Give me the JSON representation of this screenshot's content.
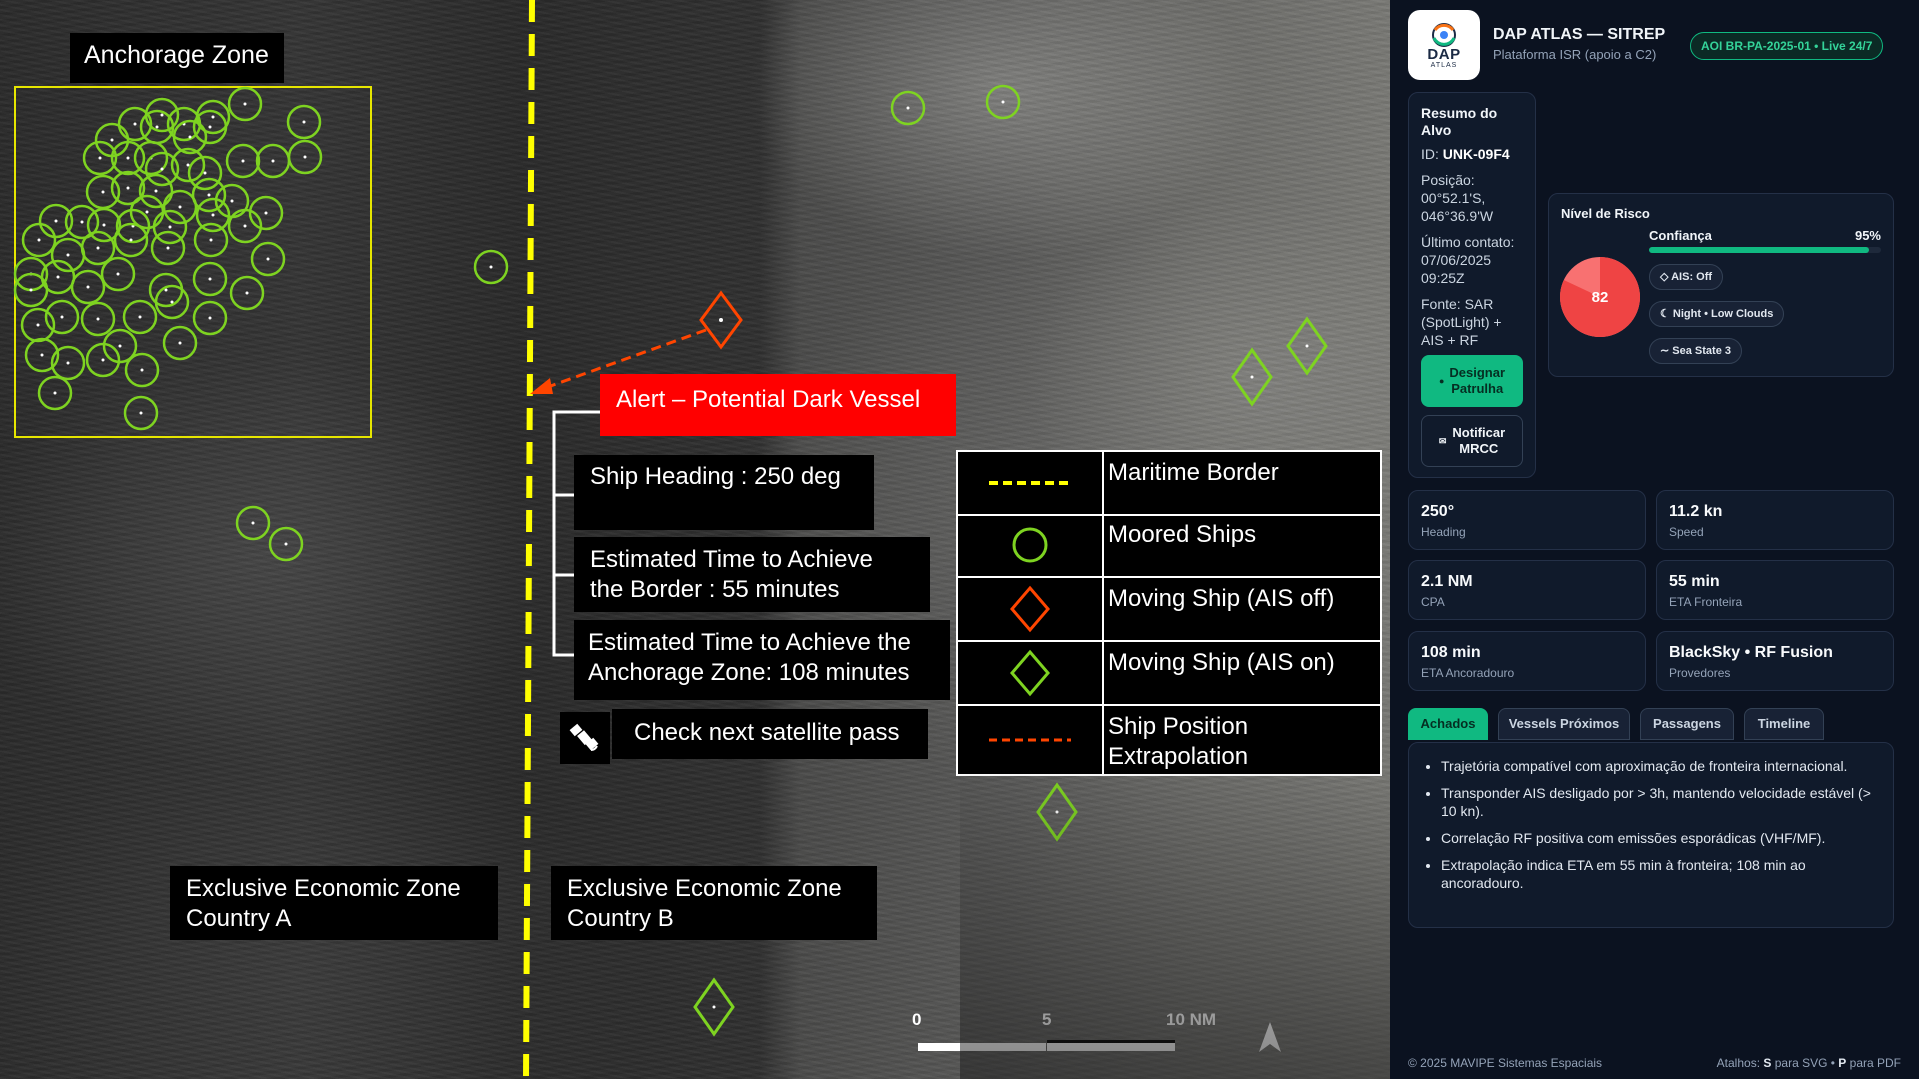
{
  "map": {
    "anchorage_label": "Anchorage Zone",
    "alert_label": "Alert – Potential Dark Vessel",
    "heading_label": "Ship Heading : 250 deg",
    "eta_border_label_1": "Estimated Time to Achieve",
    "eta_border_label_2": "the Border : 55 minutes",
    "eta_anchorage_label_1": "Estimated Time to Achieve the",
    "eta_anchorage_label_2": "Anchorage Zone: 108 minutes",
    "satellite_label": "Check next satellite pass",
    "eez_a_1": "Exclusive Economic Zone",
    "eez_a_2": "Country A",
    "eez_b_1": "Exclusive Economic Zone",
    "eez_b_2": "Country B",
    "legend": [
      {
        "label": "Maritime Border",
        "symbol": "yellow-dashed-line"
      },
      {
        "label": "Moored Ships",
        "symbol": "green-circle"
      },
      {
        "label": "Moving Ship (AIS off)",
        "symbol": "red-diamond"
      },
      {
        "label": "Moving Ship (AIS on)",
        "symbol": "green-diamond"
      },
      {
        "label": "Ship Position Extrapolation",
        "symbol": "red-dashed-line"
      }
    ],
    "scale": {
      "t0": "0",
      "t5": "5",
      "t10": "10 NM"
    },
    "north_icon": "north-arrow-icon",
    "colors": {
      "moored": "#7ed321",
      "alert": "#ff0000",
      "border": "#ffff00",
      "extrapolation": "#ff4500"
    }
  },
  "panel": {
    "logo_text": "DAP",
    "logo_sub": "ATLAS",
    "title": "DAP ATLAS — SITREP",
    "subtitle": "Plataforma ISR (apoio a C2)",
    "aoi_badge": "AOI BR-PA-2025-01 • Live 24/7",
    "summary": {
      "title_1": "Resumo do",
      "title_2": "Alvo",
      "id_label": "ID: ",
      "id_value": "UNK-09F4",
      "position_label": "Posição:",
      "position_1": "00°52.1'S,",
      "position_2": "046°36.9'W",
      "contact_label": "Último contato:",
      "contact_1": "07/06/2025",
      "contact_2": "09:25Z",
      "source_label": "Fonte: ",
      "source_1": "SAR",
      "source_2": "(SpotLight) +",
      "source_3": "AIS + RF"
    },
    "actions": {
      "designate_1": "Designar",
      "designate_2": "Patrulha",
      "notify_1": "Notificar",
      "notify_2": "MRCC"
    },
    "risk": {
      "title": "Nível de Risco",
      "score": "82",
      "score_value": 82,
      "confidence_label": "Confiança",
      "confidence_value": "95%",
      "confidence_fraction": 0.95,
      "chips": [
        "AIS: Off",
        "Night • Low Clouds",
        "Sea State 3"
      ]
    },
    "stats": [
      {
        "value": "250°",
        "label": "Heading"
      },
      {
        "value": "11.2 kn",
        "label": "Speed"
      },
      {
        "value": "2.1 NM",
        "label": "CPA"
      },
      {
        "value": "55 min",
        "label": "ETA Fronteira"
      },
      {
        "value": "108 min",
        "label": "ETA Ancoradouro"
      },
      {
        "value": "BlackSky • RF Fusion",
        "label": "Provedores"
      }
    ],
    "tabs": [
      "Achados",
      "Vessels Próximos",
      "Passagens",
      "Timeline"
    ],
    "active_tab": "Achados",
    "findings": [
      "Trajetória compatível com aproximação de fronteira internacional.",
      "Transponder AIS desligado por > 3h, mantendo velocidade estável (> 10 kn).",
      "Correlação RF positiva com emissões esporádicas (VHF/MF).",
      "Extrapolação indica ETA em 55 min à fronteira; 108 min ao ancoradouro."
    ],
    "footer_left": "© 2025 MAVIPE Sistemas Espaciais",
    "footer_right_1": "Atalhos: ",
    "footer_right_s": "S",
    "footer_right_2": " para SVG • ",
    "footer_right_p": "P",
    "footer_right_3": " para PDF"
  }
}
